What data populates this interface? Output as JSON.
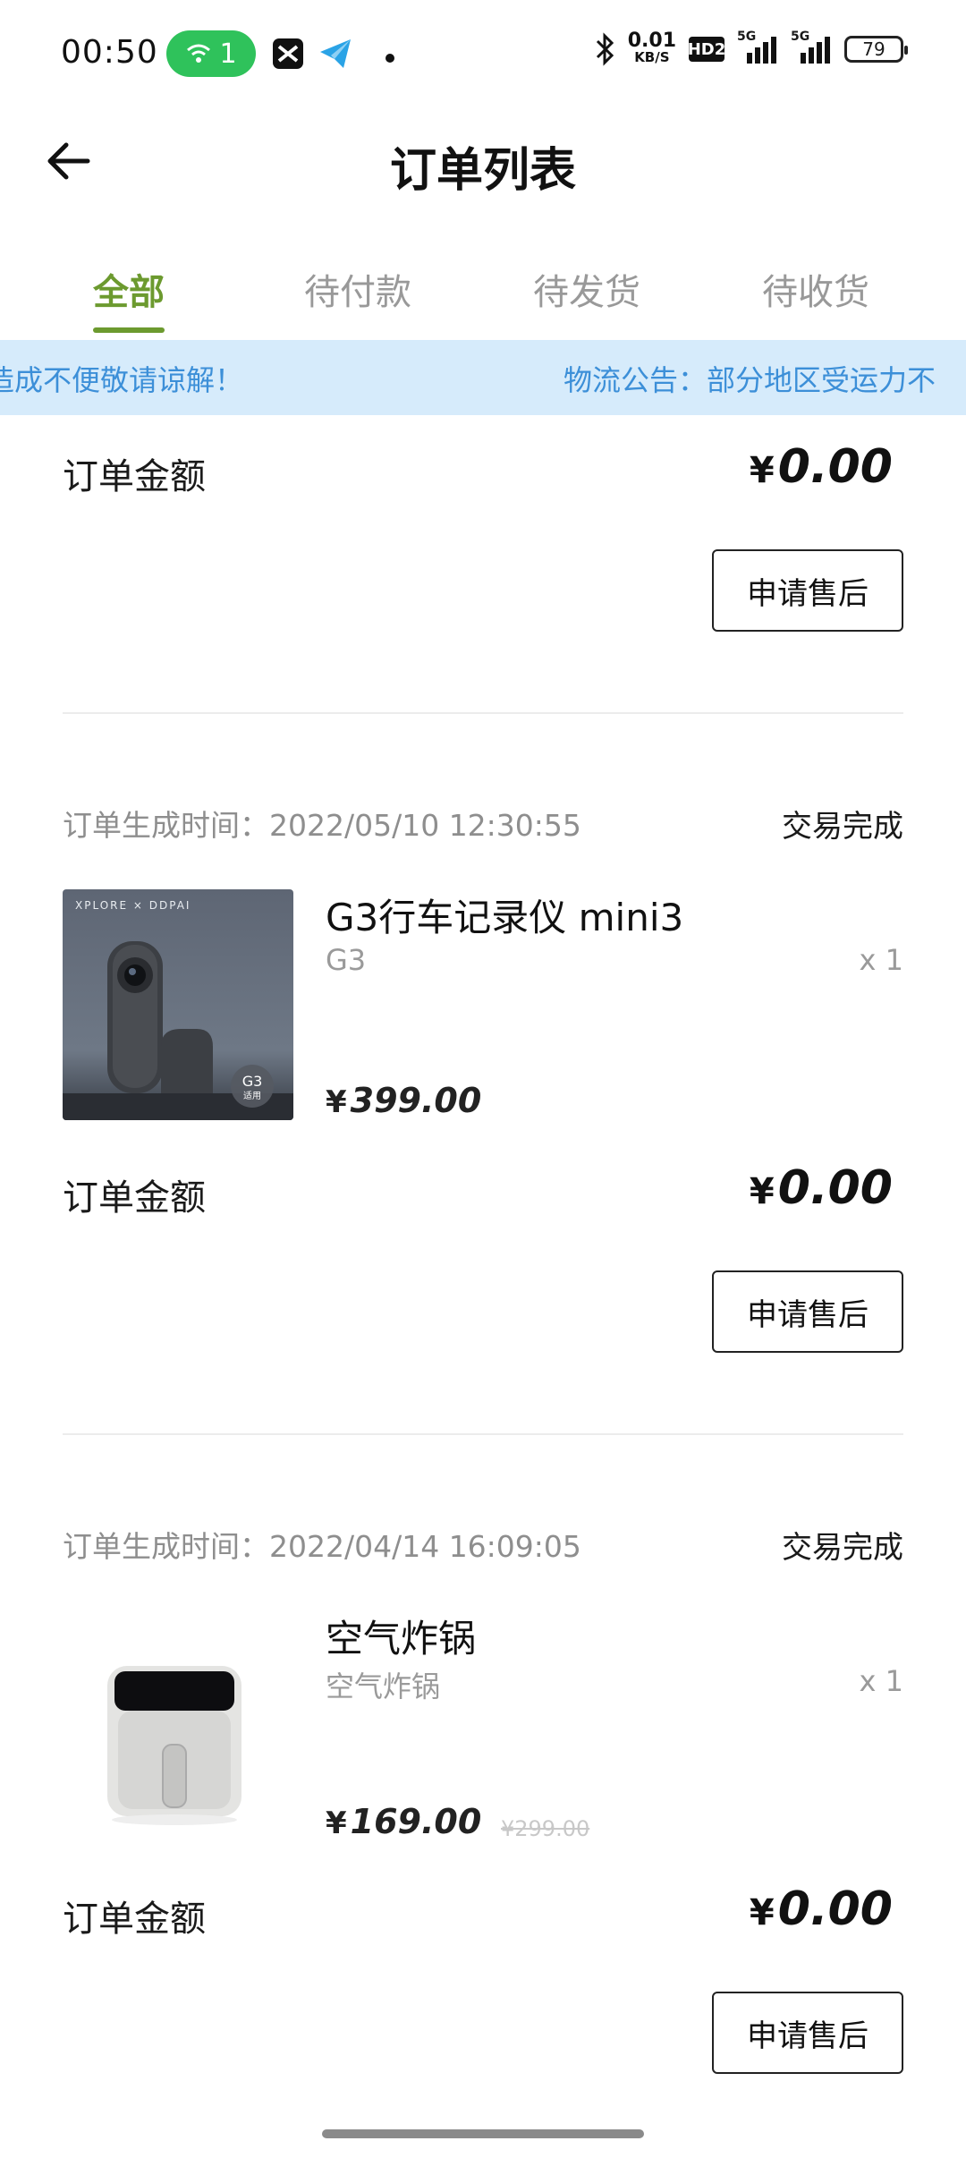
{
  "status_bar": {
    "time": "00:50",
    "wifi_badge": "1",
    "net_speed_value": "0.01",
    "net_speed_unit": "KB/S",
    "hd_label": "HD2",
    "signal_1_label": "5G",
    "signal_2_label": "5G",
    "battery": "79"
  },
  "header": {
    "title": "订单列表",
    "back_icon": "arrow-left-icon"
  },
  "tabs": [
    {
      "label": "全部",
      "active": true
    },
    {
      "label": "待付款",
      "active": false
    },
    {
      "label": "待发货",
      "active": false
    },
    {
      "label": "待收货",
      "active": false
    }
  ],
  "notice": {
    "text_left": "造成不便敬请谅解！",
    "text_right": "物流公告：部分地区受运力不"
  },
  "orders": [
    {
      "amount_label": "订单金额",
      "amount_currency": "¥",
      "amount": "0.00",
      "action": "申请售后"
    },
    {
      "time_label": "订单生成时间：2022/05/10 12:30:55",
      "status": "交易完成",
      "product_name": "G3行车记录仪 mini3",
      "product_spec": "G3",
      "quantity": "x 1",
      "price_currency": "¥",
      "price": "399.00",
      "image_brand": "XPLORE × DDPAI",
      "image_badge_top": "G3",
      "image_badge_bottom": "适用",
      "amount_label": "订单金额",
      "amount_currency": "¥",
      "amount": "0.00",
      "action": "申请售后"
    },
    {
      "time_label": "订单生成时间：2022/04/14 16:09:05",
      "status": "交易完成",
      "product_name": "空气炸锅",
      "product_spec": "空气炸锅",
      "quantity": "x 1",
      "price_currency": "¥",
      "price": "169.00",
      "original_price": "¥299.00",
      "amount_label": "订单金额",
      "amount_currency": "¥",
      "amount": "0.00",
      "action": "申请售后"
    }
  ],
  "colors": {
    "accent": "#6c9a2f",
    "notice_bg": "#d6ebfb",
    "notice_text": "#3c8fd8",
    "wifi_pill": "#2fc25b"
  }
}
